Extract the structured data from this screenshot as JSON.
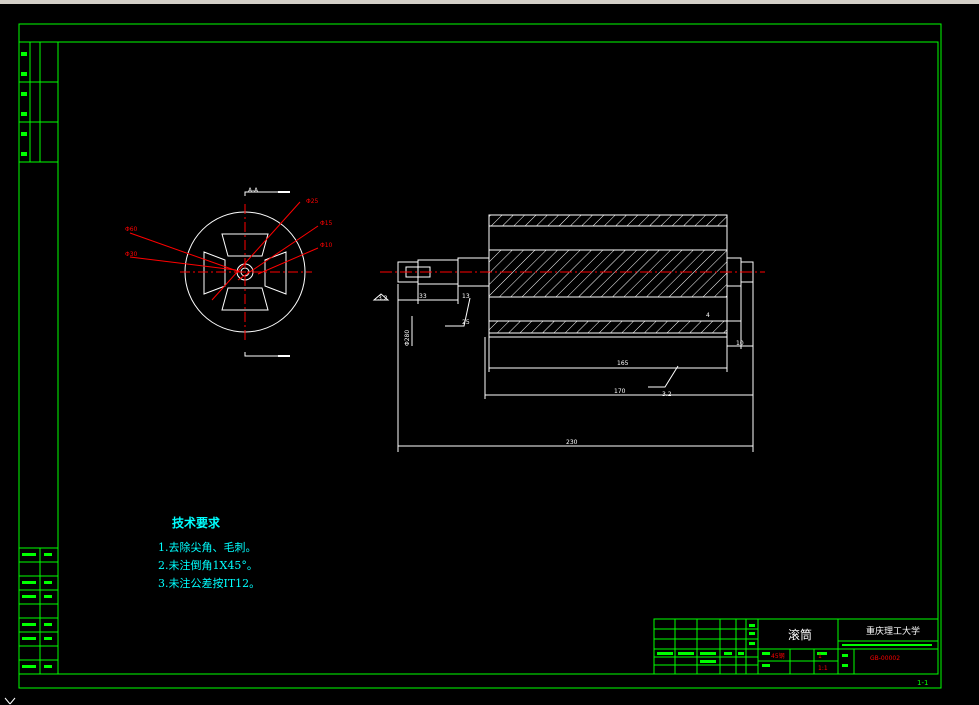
{
  "section_label": "A-A",
  "section_dims": [
    "Φ60",
    "Φ30",
    "Φ25",
    "Φ15",
    "Φ10"
  ],
  "shaft_dims": {
    "d33": "33",
    "d13": "13",
    "d4": "4",
    "d10": "10",
    "d165": "165",
    "d170": "170",
    "d230": "230",
    "diam": "Φ280"
  },
  "roughness": [
    "3.2",
    "25",
    "3.2"
  ],
  "tech": {
    "title": "技术要求",
    "items": [
      "1.去除尖角、毛刺。",
      "2.未注倒角1X45°。",
      "3.未注公差按IT12。"
    ]
  },
  "title_block": {
    "part_name": "滚筒",
    "school": "重庆理工大学",
    "material": "45钢",
    "drawing_no": "GB-00002",
    "scale": "1:1",
    "qty": "1"
  },
  "page_number": "1-1",
  "colors": {
    "frame": "#00ff00",
    "line": "#ffffff",
    "dim": "#ff0000",
    "text": "#00ffff"
  }
}
